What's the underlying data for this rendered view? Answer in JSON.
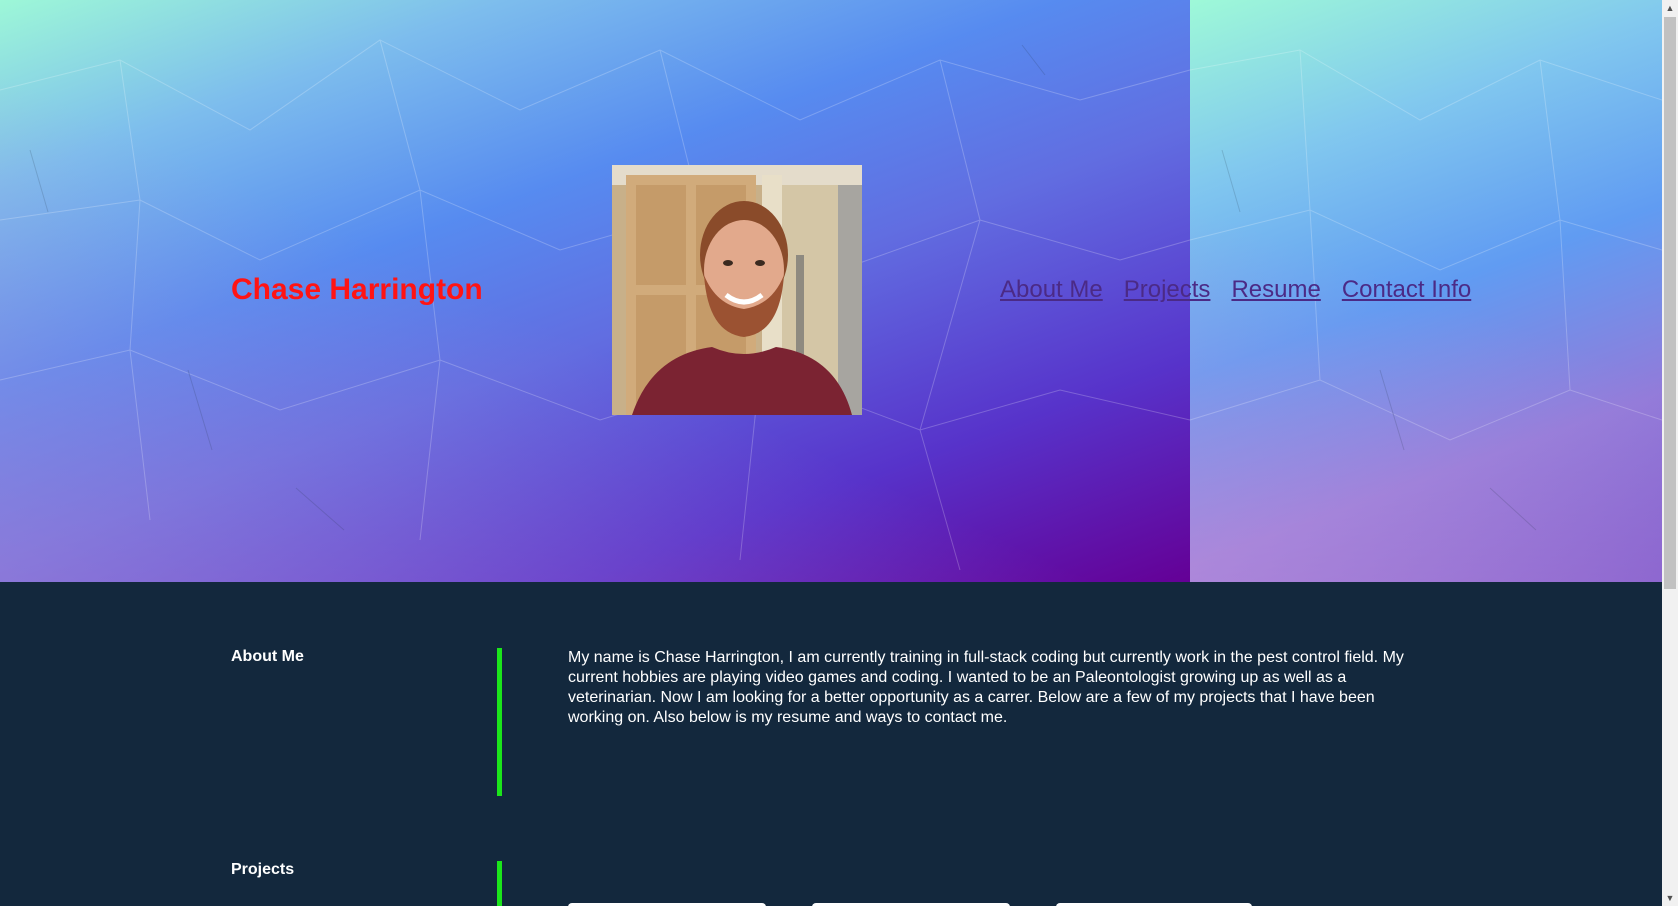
{
  "header": {
    "site_title": "Chase Harrington",
    "nav": [
      {
        "label": "About Me"
      },
      {
        "label": "Projects"
      },
      {
        "label": "Resume"
      },
      {
        "label": "Contact Info"
      }
    ]
  },
  "about": {
    "heading": "About Me",
    "text": "My name is Chase Harrington, I am currently training in full-stack coding but currently work in the pest control field. My current hobbies are playing video games and coding. I wanted to be an Paleontologist growing up as well as a veterinarian. Now I am looking for a better opportunity as a carrer. Below are a few of my projects that I have been working on. Also below is my resume and ways to contact me."
  },
  "projects": {
    "heading": "Projects"
  },
  "colors": {
    "title": "#ff1414",
    "nav_link": "#4b2a86",
    "content_bg": "#13283d",
    "divider": "#1be51b"
  },
  "icons": {
    "scroll_up": "chevron-up-icon",
    "scroll_down": "chevron-down-icon"
  }
}
